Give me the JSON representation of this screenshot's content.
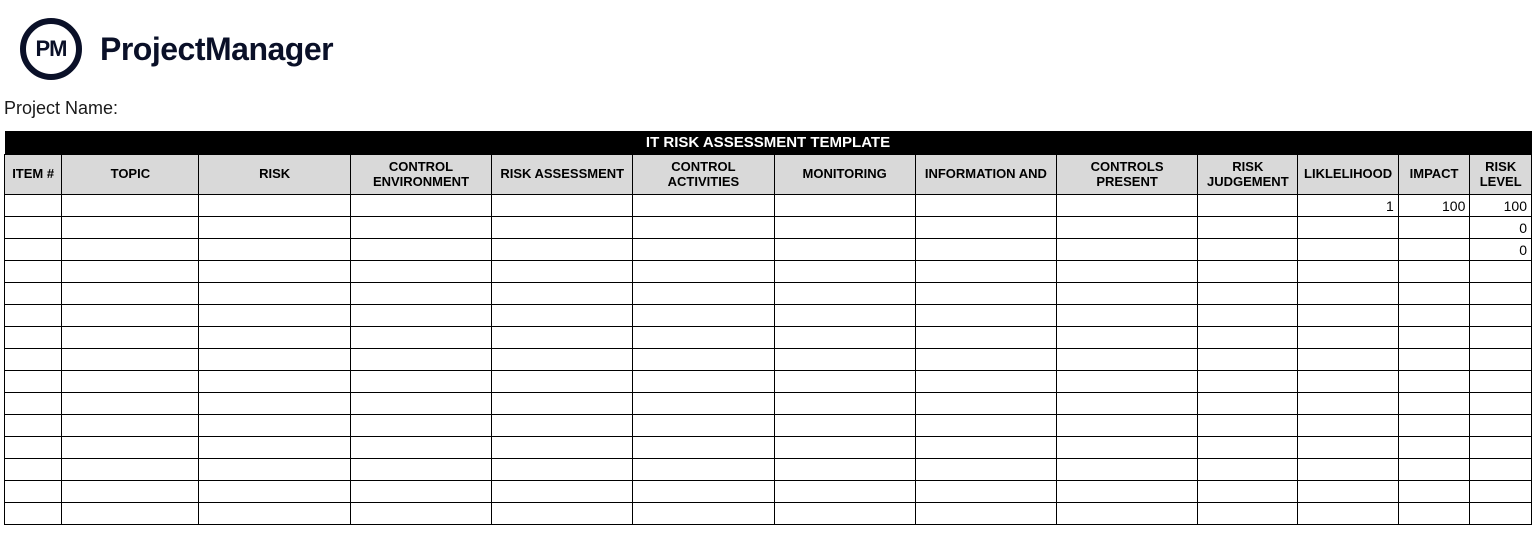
{
  "brand": {
    "logo_initials": "PM",
    "name": "ProjectManager"
  },
  "project_name_label": "Project Name:",
  "table": {
    "title": "IT RISK ASSESSMENT TEMPLATE",
    "columns": [
      "ITEM #",
      "TOPIC",
      "RISK",
      "CONTROL ENVIRONMENT",
      "RISK ASSESSMENT",
      "CONTROL ACTIVITIES",
      "MONITORING",
      "INFORMATION AND",
      "CONTROLS PRESENT",
      "RISK JUDGEMENT",
      "LIKLELIHOOD",
      "IMPACT",
      "RISK LEVEL"
    ],
    "rows": [
      {
        "item": "",
        "topic": "",
        "risk": "",
        "control_env": "",
        "risk_assess": "",
        "control_act": "",
        "monitoring": "",
        "info": "",
        "controls_present": "",
        "risk_judge": "",
        "likelihood": "1",
        "impact": "100",
        "risk_level": "100"
      },
      {
        "item": "",
        "topic": "",
        "risk": "",
        "control_env": "",
        "risk_assess": "",
        "control_act": "",
        "monitoring": "",
        "info": "",
        "controls_present": "",
        "risk_judge": "",
        "likelihood": "",
        "impact": "",
        "risk_level": "0"
      },
      {
        "item": "",
        "topic": "",
        "risk": "",
        "control_env": "",
        "risk_assess": "",
        "control_act": "",
        "monitoring": "",
        "info": "",
        "controls_present": "",
        "risk_judge": "",
        "likelihood": "",
        "impact": "",
        "risk_level": "0"
      },
      {
        "item": "",
        "topic": "",
        "risk": "",
        "control_env": "",
        "risk_assess": "",
        "control_act": "",
        "monitoring": "",
        "info": "",
        "controls_present": "",
        "risk_judge": "",
        "likelihood": "",
        "impact": "",
        "risk_level": ""
      },
      {
        "item": "",
        "topic": "",
        "risk": "",
        "control_env": "",
        "risk_assess": "",
        "control_act": "",
        "monitoring": "",
        "info": "",
        "controls_present": "",
        "risk_judge": "",
        "likelihood": "",
        "impact": "",
        "risk_level": ""
      },
      {
        "item": "",
        "topic": "",
        "risk": "",
        "control_env": "",
        "risk_assess": "",
        "control_act": "",
        "monitoring": "",
        "info": "",
        "controls_present": "",
        "risk_judge": "",
        "likelihood": "",
        "impact": "",
        "risk_level": ""
      },
      {
        "item": "",
        "topic": "",
        "risk": "",
        "control_env": "",
        "risk_assess": "",
        "control_act": "",
        "monitoring": "",
        "info": "",
        "controls_present": "",
        "risk_judge": "",
        "likelihood": "",
        "impact": "",
        "risk_level": ""
      },
      {
        "item": "",
        "topic": "",
        "risk": "",
        "control_env": "",
        "risk_assess": "",
        "control_act": "",
        "monitoring": "",
        "info": "",
        "controls_present": "",
        "risk_judge": "",
        "likelihood": "",
        "impact": "",
        "risk_level": ""
      },
      {
        "item": "",
        "topic": "",
        "risk": "",
        "control_env": "",
        "risk_assess": "",
        "control_act": "",
        "monitoring": "",
        "info": "",
        "controls_present": "",
        "risk_judge": "",
        "likelihood": "",
        "impact": "",
        "risk_level": ""
      },
      {
        "item": "",
        "topic": "",
        "risk": "",
        "control_env": "",
        "risk_assess": "",
        "control_act": "",
        "monitoring": "",
        "info": "",
        "controls_present": "",
        "risk_judge": "",
        "likelihood": "",
        "impact": "",
        "risk_level": ""
      },
      {
        "item": "",
        "topic": "",
        "risk": "",
        "control_env": "",
        "risk_assess": "",
        "control_act": "",
        "monitoring": "",
        "info": "",
        "controls_present": "",
        "risk_judge": "",
        "likelihood": "",
        "impact": "",
        "risk_level": ""
      },
      {
        "item": "",
        "topic": "",
        "risk": "",
        "control_env": "",
        "risk_assess": "",
        "control_act": "",
        "monitoring": "",
        "info": "",
        "controls_present": "",
        "risk_judge": "",
        "likelihood": "",
        "impact": "",
        "risk_level": ""
      },
      {
        "item": "",
        "topic": "",
        "risk": "",
        "control_env": "",
        "risk_assess": "",
        "control_act": "",
        "monitoring": "",
        "info": "",
        "controls_present": "",
        "risk_judge": "",
        "likelihood": "",
        "impact": "",
        "risk_level": ""
      },
      {
        "item": "",
        "topic": "",
        "risk": "",
        "control_env": "",
        "risk_assess": "",
        "control_act": "",
        "monitoring": "",
        "info": "",
        "controls_present": "",
        "risk_judge": "",
        "likelihood": "",
        "impact": "",
        "risk_level": ""
      },
      {
        "item": "",
        "topic": "",
        "risk": "",
        "control_env": "",
        "risk_assess": "",
        "control_act": "",
        "monitoring": "",
        "info": "",
        "controls_present": "",
        "risk_judge": "",
        "likelihood": "",
        "impact": "",
        "risk_level": ""
      }
    ]
  }
}
